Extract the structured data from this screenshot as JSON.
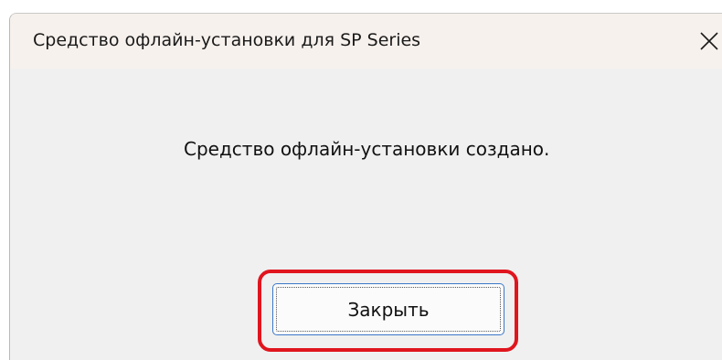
{
  "dialog": {
    "title": "Средство офлайн-установки для SP Series",
    "message": "Средство офлайн-установки создано.",
    "close_button_label": "Закрыть",
    "close_icon": "close-icon",
    "highlight_color": "#e0151e",
    "accent_color": "#3c78c8"
  }
}
